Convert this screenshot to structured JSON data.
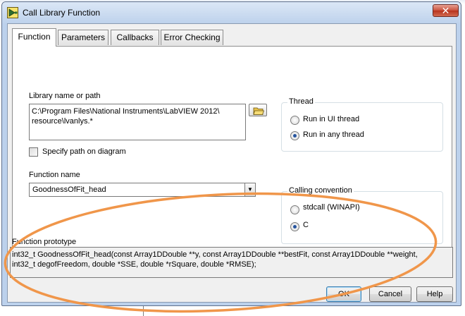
{
  "window": {
    "title": "Call Library Function",
    "close_glyph": "✕"
  },
  "tabs": [
    {
      "label": "Function",
      "active": true
    },
    {
      "label": "Parameters",
      "active": false
    },
    {
      "label": "Callbacks",
      "active": false
    },
    {
      "label": "Error Checking",
      "active": false
    }
  ],
  "library": {
    "label": "Library name or path",
    "value": "C:\\Program Files\\National Instruments\\LabVIEW 2012\\\nresource\\lvanlys.*",
    "browse_icon": "folder-open-icon",
    "specify_path_label": "Specify path on diagram",
    "specify_path_checked": false
  },
  "thread": {
    "title": "Thread",
    "options": [
      {
        "label": "Run in UI thread",
        "selected": false
      },
      {
        "label": "Run in any thread",
        "selected": true
      }
    ]
  },
  "function_name": {
    "label": "Function name",
    "value": "GoodnessOfFit_head",
    "dropdown_glyph": "▼"
  },
  "calling_convention": {
    "title": "Calling convention",
    "options": [
      {
        "label": "stdcall (WINAPI)",
        "selected": false
      },
      {
        "label": "C",
        "selected": true
      }
    ]
  },
  "prototype": {
    "label": "Function prototype",
    "text": "int32_t GoodnessOfFit_head(const Array1DDouble **y, const Array1DDouble **bestFit, const Array1DDouble **weight,\nint32_t degofFreedom, double *SSE, double *rSquare, double *RMSE);"
  },
  "buttons": {
    "ok": "OK",
    "cancel": "Cancel",
    "help": "Help"
  },
  "colors": {
    "annotation_ellipse": "#f0964a",
    "radio_selected": "#26549e",
    "titlebar": "#bed2ec"
  }
}
